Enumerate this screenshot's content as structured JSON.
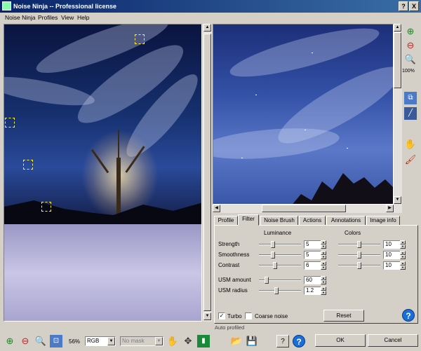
{
  "window": {
    "title": "Noise Ninja -- Professional license",
    "help_btn": "?",
    "close_btn": "X"
  },
  "menu": [
    "Noise Ninja",
    "Profiles",
    "View",
    "Help"
  ],
  "zoom_label": "100%",
  "tabs": [
    "Profile",
    "Filter",
    "Noise Brush",
    "Actions",
    "Annotations",
    "Image info"
  ],
  "active_tab": "Filter",
  "filter": {
    "luminance_header": "Luminance",
    "colors_header": "Colors",
    "rows": [
      {
        "label": "Strength",
        "lum": "5",
        "col": "10"
      },
      {
        "label": "Smoothness",
        "lum": "5",
        "col": "10"
      },
      {
        "label": "Contrast",
        "lum": "6",
        "col": "10"
      }
    ],
    "usm": [
      {
        "label": "USM amount",
        "value": "60"
      },
      {
        "label": "USM radius",
        "value": "1.2"
      }
    ],
    "turbo_label": "Turbo",
    "turbo_checked": true,
    "coarse_label": "Coarse noise",
    "coarse_checked": false,
    "reset_label": "Reset"
  },
  "status_text": "Auto profiled",
  "bottom": {
    "zoom_percent": "56%",
    "color_mode": "RGB",
    "mask_select": "No mask",
    "ok_label": "OK",
    "cancel_label": "Cancel"
  },
  "colors": {
    "title_start": "#0a246a",
    "title_end": "#3a6ea5",
    "help_blue": "#1a6ed8",
    "face": "#d4d0c8"
  }
}
